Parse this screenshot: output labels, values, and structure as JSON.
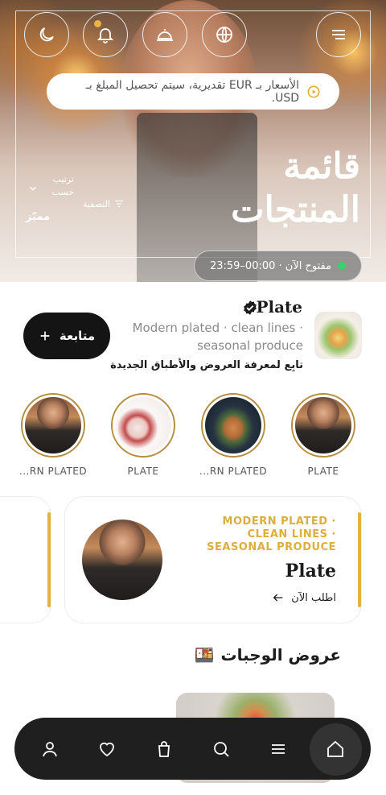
{
  "hero": {
    "title_line1": "قائمة",
    "title_line2": "المنتجات",
    "notice": "الأسعار بـ EUR تقديرية، سيتم تحصيل المبلغ بـ USD.",
    "sort_label": "ترتيب حسب",
    "filter_label": "التصفية",
    "featured_label": "مميّز",
    "open_status": "مفتوح الآن · 00:00–23:59",
    "top_icons": [
      "moon-icon",
      "bell-icon",
      "cloche-icon",
      "globe-icon",
      "menu-icon"
    ]
  },
  "brand": {
    "name": "Plate",
    "description": "Modern plated · clean lines · seasonal produce",
    "follow_hint": "تابِع لمعرفة العروض والأطباق الجديدة",
    "follow_button": "متابعة"
  },
  "stories": [
    {
      "label": "PLATE",
      "image": "chef"
    },
    {
      "label": "...RN PLATED",
      "image": "sandwich"
    },
    {
      "label": "PLATE",
      "image": "dessert"
    },
    {
      "label": "...RN PLATED",
      "image": "chef"
    }
  ],
  "card": {
    "tags": "MODERN PLATED · CLEAN LINES · SEASONAL PRODUCE",
    "title": "Plate",
    "order_label": "اطلب الآن"
  },
  "meals": {
    "title": "عروض الوجبات",
    "emoji": "🍱"
  },
  "nav": [
    "user-icon",
    "heart-icon",
    "bag-icon",
    "search-icon",
    "menu-icon",
    "home-icon"
  ],
  "colors": {
    "accent": "#e0b444",
    "dark": "#141414",
    "open_dot": "#3ccf6a"
  }
}
